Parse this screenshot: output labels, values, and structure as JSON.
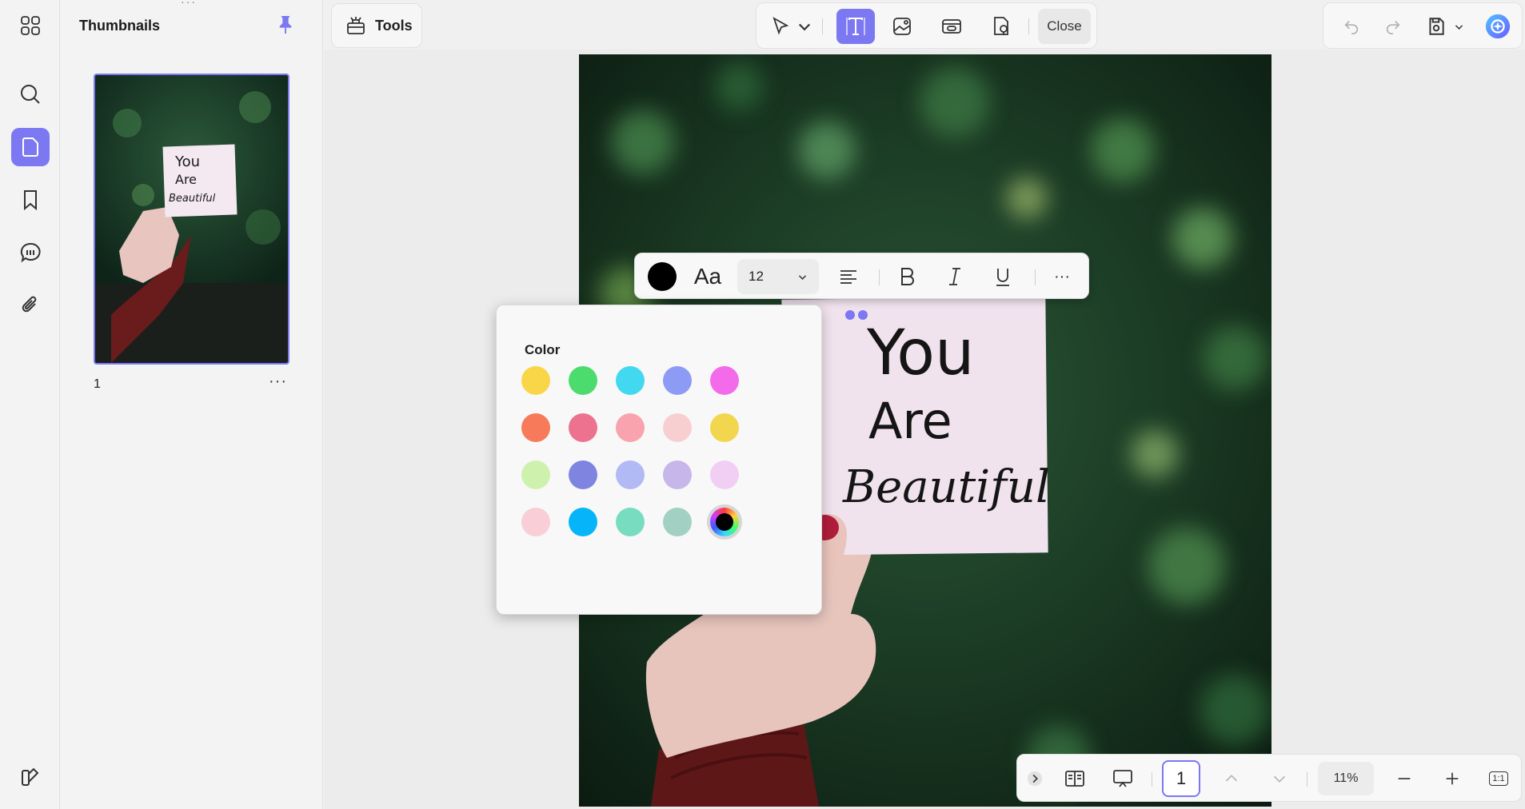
{
  "sidebar": {
    "items": [
      {
        "name": "apps-icon"
      },
      {
        "name": "search-icon"
      },
      {
        "name": "thumbnails-icon",
        "active": true
      },
      {
        "name": "bookmark-icon"
      },
      {
        "name": "comment-icon"
      },
      {
        "name": "attachment-icon"
      }
    ],
    "bottom_icon": "themes-icon"
  },
  "thumbnails_panel": {
    "title": "Thumbnails",
    "pages": [
      {
        "number": "1"
      }
    ],
    "more_label": "···"
  },
  "toolbar": {
    "tools_label": "Tools",
    "close_label": "Close",
    "active_tool": "add-text",
    "tools": [
      "select-tool",
      "add-text",
      "add-image",
      "add-link",
      "add-stamp"
    ]
  },
  "text_format": {
    "color": "#000000",
    "font_label": "Aa",
    "font_size": "12",
    "more_label": "···"
  },
  "color_picker": {
    "title": "Color",
    "swatches": [
      [
        "#f9d648",
        "#4cdc6d",
        "#42d9f0",
        "#8e9bf5",
        "#f36bea"
      ],
      [
        "#f77a5a",
        "#ec728f",
        "#f8a3ad",
        "#f8cfd0",
        "#f2d64e"
      ],
      [
        "#cef2ae",
        "#7e84e0",
        "#b1baf5",
        "#c6b6ea",
        "#f1cff5"
      ],
      [
        "#f9ced6",
        "#06b5f9",
        "#78ddc0",
        "#a2d1c3",
        "custom"
      ]
    ]
  },
  "page_content": {
    "note_text": [
      "You",
      "Are",
      "Beautiful"
    ],
    "accent": "#7b78f2"
  },
  "bottom_bar": {
    "page_number": "1",
    "zoom": "11%",
    "fit_label": "1:1"
  }
}
